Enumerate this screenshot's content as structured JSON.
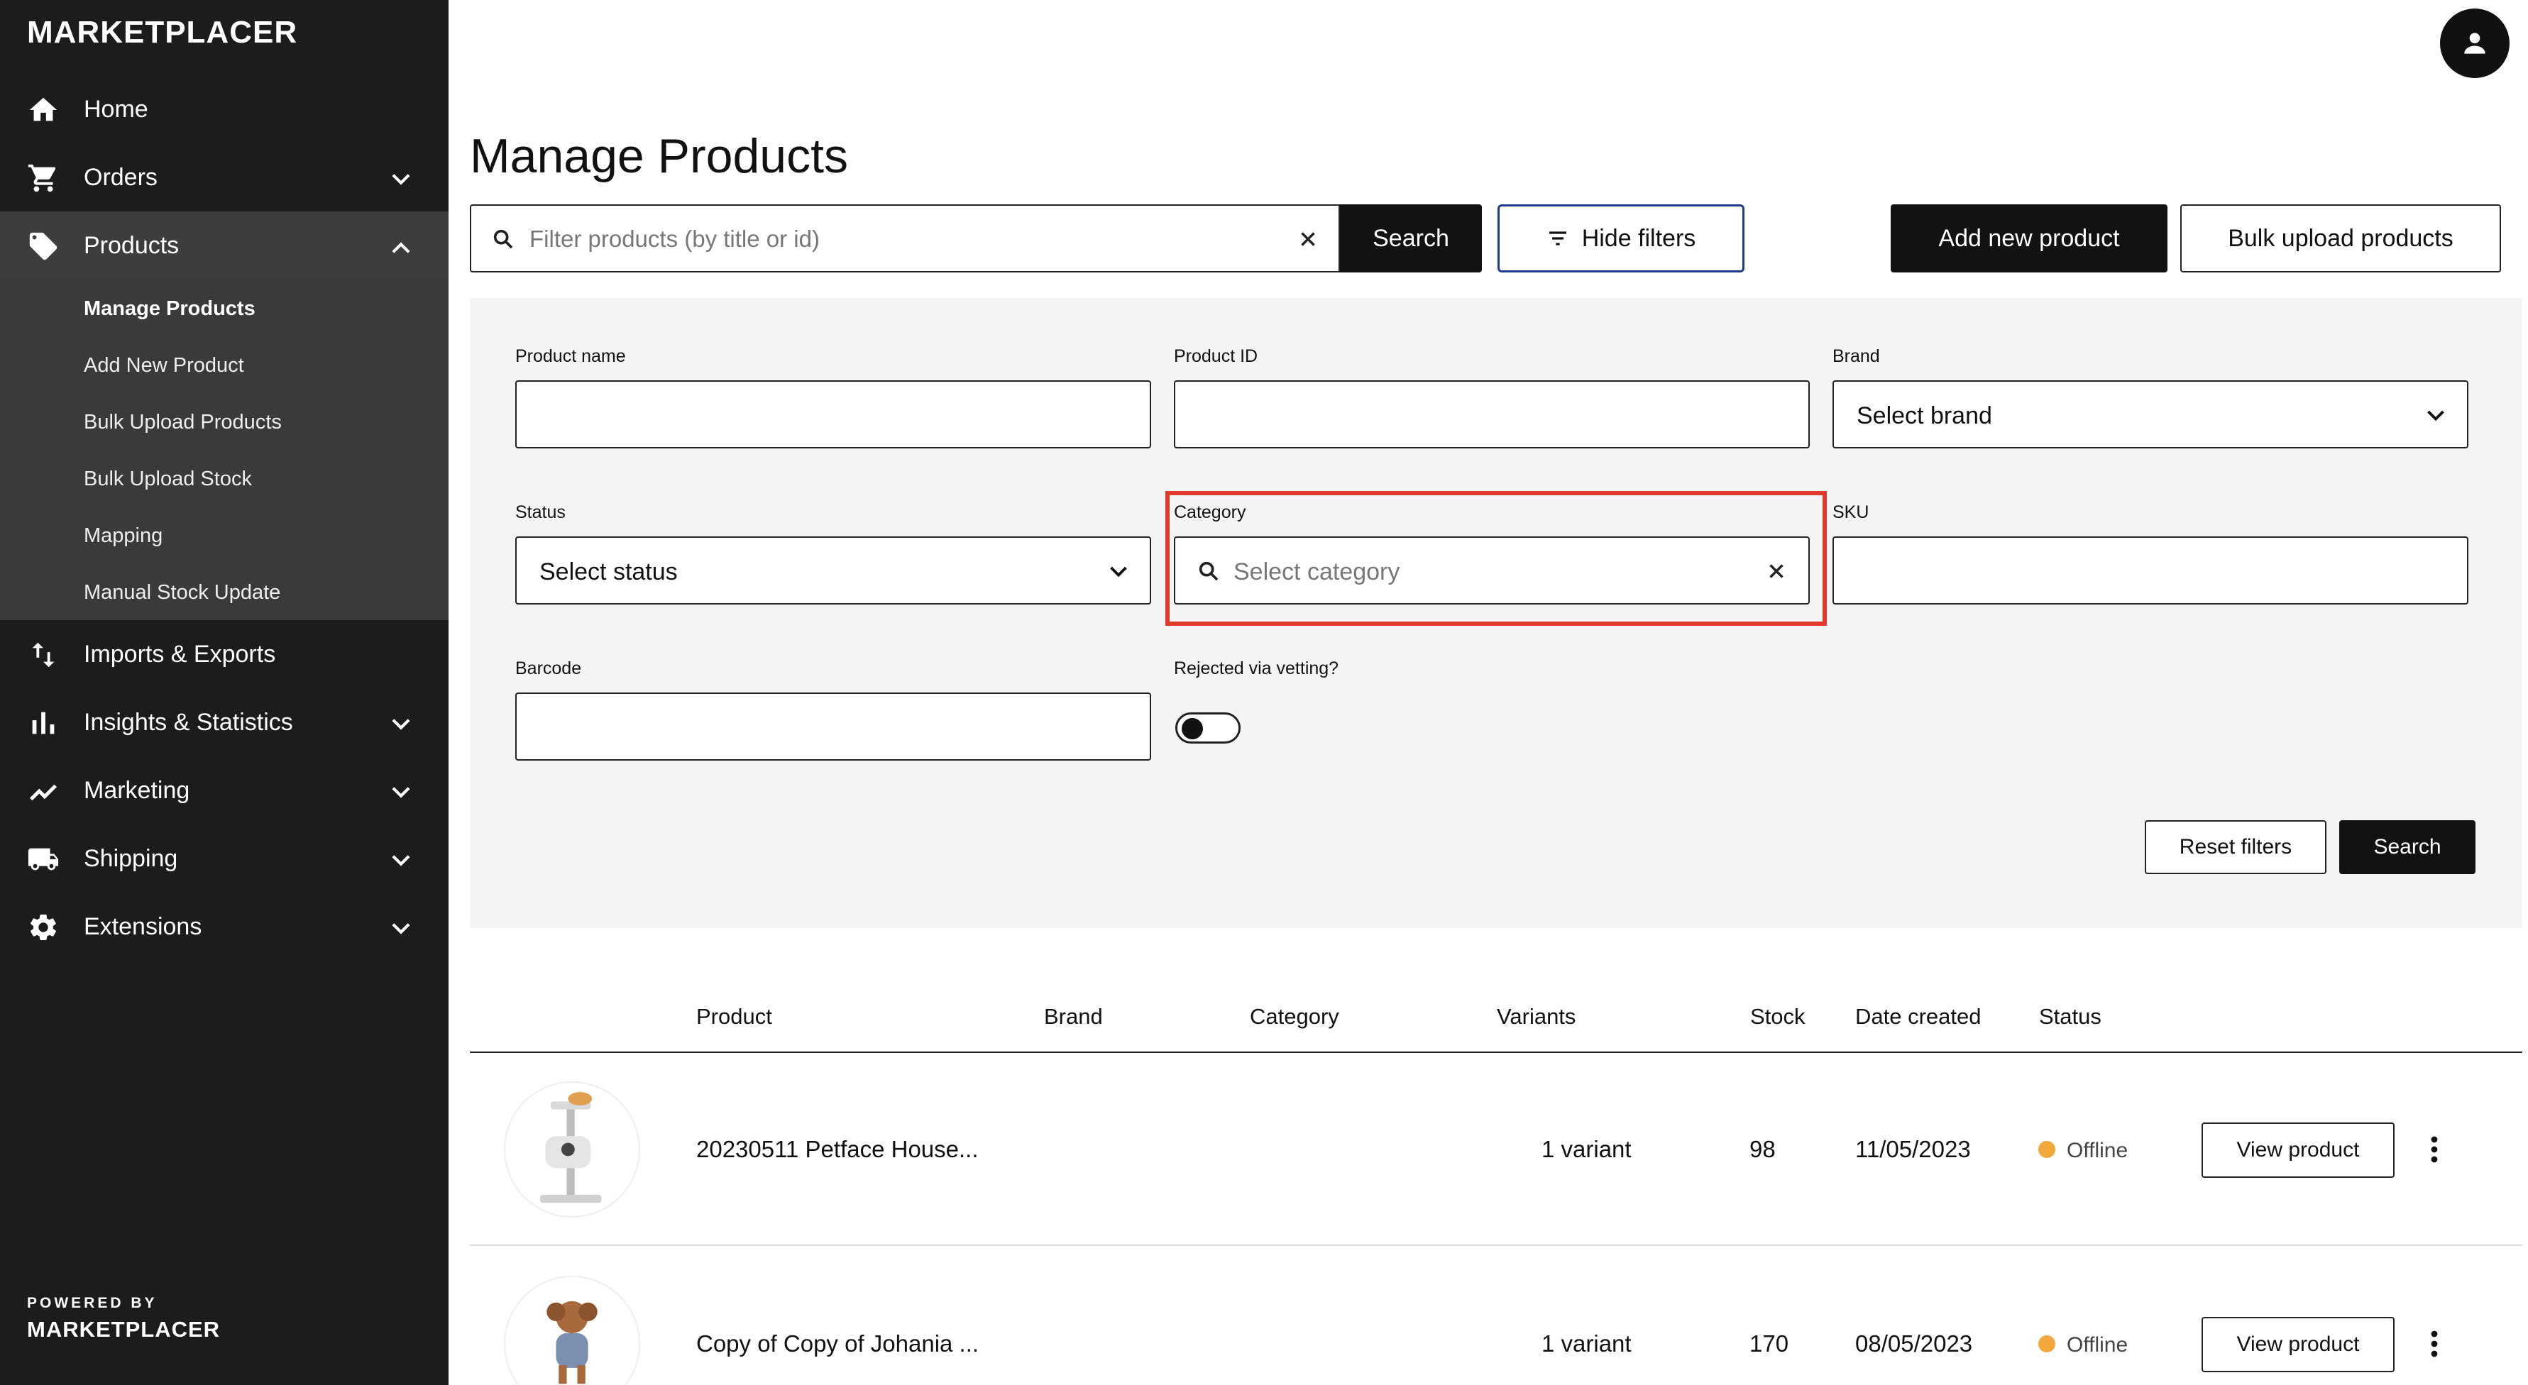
{
  "brand": {
    "logo_text": "MARKETPLACER",
    "powered_by": "POWERED BY",
    "powered_logo": "MARKETPLACER"
  },
  "sidebar": {
    "items": [
      {
        "label": "Home",
        "icon": "home-icon"
      },
      {
        "label": "Orders",
        "icon": "cart-icon"
      },
      {
        "label": "Products",
        "icon": "tag-icon"
      },
      {
        "label": "Imports & Exports",
        "icon": "arrows-updown-icon"
      },
      {
        "label": "Insights & Statistics",
        "icon": "bar-chart-icon"
      },
      {
        "label": "Marketing",
        "icon": "trend-icon"
      },
      {
        "label": "Shipping",
        "icon": "truck-icon"
      },
      {
        "label": "Extensions",
        "icon": "gear-icon"
      }
    ],
    "products_sub": [
      "Manage Products",
      "Add New Product",
      "Bulk Upload Products",
      "Bulk Upload Stock",
      "Mapping",
      "Manual Stock Update"
    ]
  },
  "header": {
    "title": "Manage Products"
  },
  "toolbar": {
    "search_placeholder": "Filter products (by title or id)",
    "search_label": "Search",
    "hide_filters_label": "Hide filters",
    "add_new_label": "Add new product",
    "bulk_upload_label": "Bulk upload products"
  },
  "filters": {
    "product_name_label": "Product name",
    "product_id_label": "Product ID",
    "brand_label": "Brand",
    "brand_value": "Select brand",
    "status_label": "Status",
    "status_value": "Select status",
    "category_label": "Category",
    "category_placeholder": "Select category",
    "sku_label": "SKU",
    "barcode_label": "Barcode",
    "rejected_label": "Rejected via vetting?",
    "reset_label": "Reset filters",
    "search_label": "Search"
  },
  "table": {
    "headers": {
      "product": "Product",
      "brand": "Brand",
      "category": "Category",
      "variants": "Variants",
      "stock": "Stock",
      "date_created": "Date created",
      "status": "Status"
    },
    "rows": [
      {
        "product": "20230511 Petface House...",
        "variants": "1 variant",
        "stock": "98",
        "date_created": "11/05/2023",
        "status": "Offline",
        "action": "View product"
      },
      {
        "product": "Copy of Copy of Johania ...",
        "variants": "1 variant",
        "stock": "170",
        "date_created": "08/05/2023",
        "status": "Offline",
        "action": "View product"
      }
    ]
  },
  "colors": {
    "sidebar_bg": "#1c1c1c",
    "highlight_red": "#e23a2a",
    "status_offline": "#f2a83b",
    "focus_blue": "#1e3a8a"
  }
}
